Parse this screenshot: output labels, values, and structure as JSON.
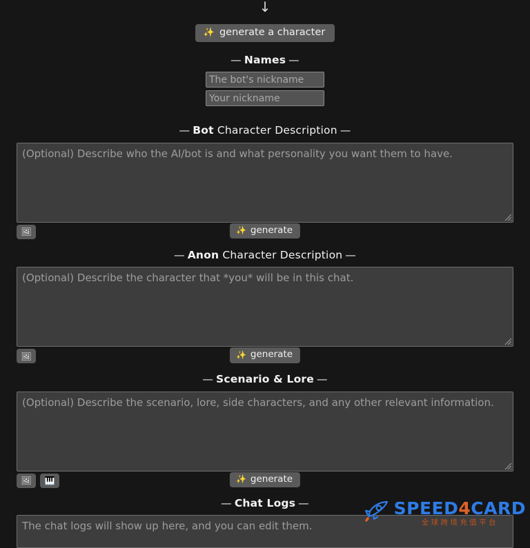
{
  "page": {
    "background_color": "#161616",
    "arrow_icon": "↓"
  },
  "generate_character": {
    "icon": "✨",
    "label": "generate a character"
  },
  "sections": {
    "names": {
      "heading_dash": "—",
      "heading_text": "Names",
      "bot_nickname_placeholder": "The bot's nickname",
      "bot_nickname_value": "",
      "your_nickname_placeholder": "Your nickname",
      "your_nickname_value": ""
    },
    "bot_description": {
      "heading_dash": "—",
      "heading_strong": "Bot",
      "heading_normal": " Character Description",
      "placeholder": "(Optional) Describe who the AI/bot is and what personality you want them to have.",
      "value": "",
      "image_button_icon": "🖼",
      "generate_icon": "✨",
      "generate_label": "generate"
    },
    "anon_description": {
      "heading_dash": "—",
      "heading_strong": "Anon",
      "heading_normal": " Character Description",
      "placeholder": "(Optional) Describe the character that *you* will be in this chat.",
      "value": "",
      "image_button_icon": "🖼",
      "generate_icon": "✨",
      "generate_label": "generate"
    },
    "scenario_lore": {
      "heading_dash": "—",
      "heading_text": "Scenario & Lore",
      "placeholder": "(Optional) Describe the scenario, lore, side characters, and any other relevant information.",
      "value": "",
      "image_button_icon": "🖼",
      "keyboard_button_icon": "🎹",
      "generate_icon": "✨",
      "generate_label": "generate"
    },
    "chat_logs": {
      "heading_dash": "—",
      "heading_text": "Chat Logs",
      "placeholder": "The chat logs will show up here, and you can edit them.",
      "value": ""
    }
  },
  "watermark": {
    "brand_speed": "SPEED",
    "brand_four": "4",
    "brand_card": "CARD",
    "subtitle": "全球跨境充值平台",
    "color_blue": "#2f80ed",
    "color_orange": "#e2662a"
  }
}
